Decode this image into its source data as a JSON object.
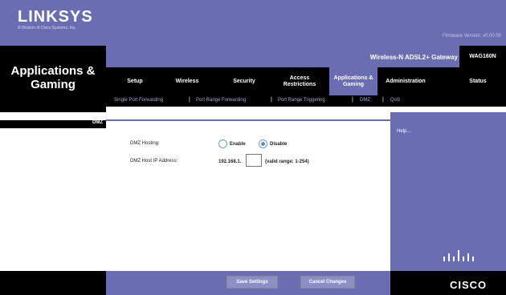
{
  "brand": {
    "logo": "LINKSYS",
    "logo_sub": "A Division of Cisco Systems, Inc.",
    "firmware": "Firmware Version: v0.00.00"
  },
  "header": {
    "section_title": "Applications & Gaming",
    "product_name": "Wireless-N ADSL2+ Gateway",
    "model": "WAG160N"
  },
  "tabs": [
    {
      "label": "Setup"
    },
    {
      "label": "Wireless"
    },
    {
      "label": "Security"
    },
    {
      "label": "Access Restrictions"
    },
    {
      "label": "Applications & Gaming"
    },
    {
      "label": "Administration"
    },
    {
      "label": "Status"
    }
  ],
  "subtabs": [
    {
      "label": "Single Port Forwarding"
    },
    {
      "label": "Port Range Forwarding"
    },
    {
      "label": "Port Range Triggering"
    },
    {
      "label": "DMZ"
    },
    {
      "label": "QoS"
    }
  ],
  "left": {
    "heading": "DMZ"
  },
  "form": {
    "dmz_hosting_label": "DMZ Hosting:",
    "enable_label": "Enable",
    "disable_label": "Disable",
    "selected": "Disable",
    "ip_label": "DMZ Host IP Address:",
    "ip_prefix": "192.168.1.",
    "ip_value": "",
    "valid_range": "(valid range: 1-254)"
  },
  "help": {
    "label": "Help..."
  },
  "footer": {
    "save_label": "Save Settings",
    "cancel_label": "Cancel Changes",
    "cisco_text": "CISCO"
  },
  "colors": {
    "accent": "#6b6db3",
    "dark": "#000000",
    "subtab_active": "#8fb0ff"
  }
}
